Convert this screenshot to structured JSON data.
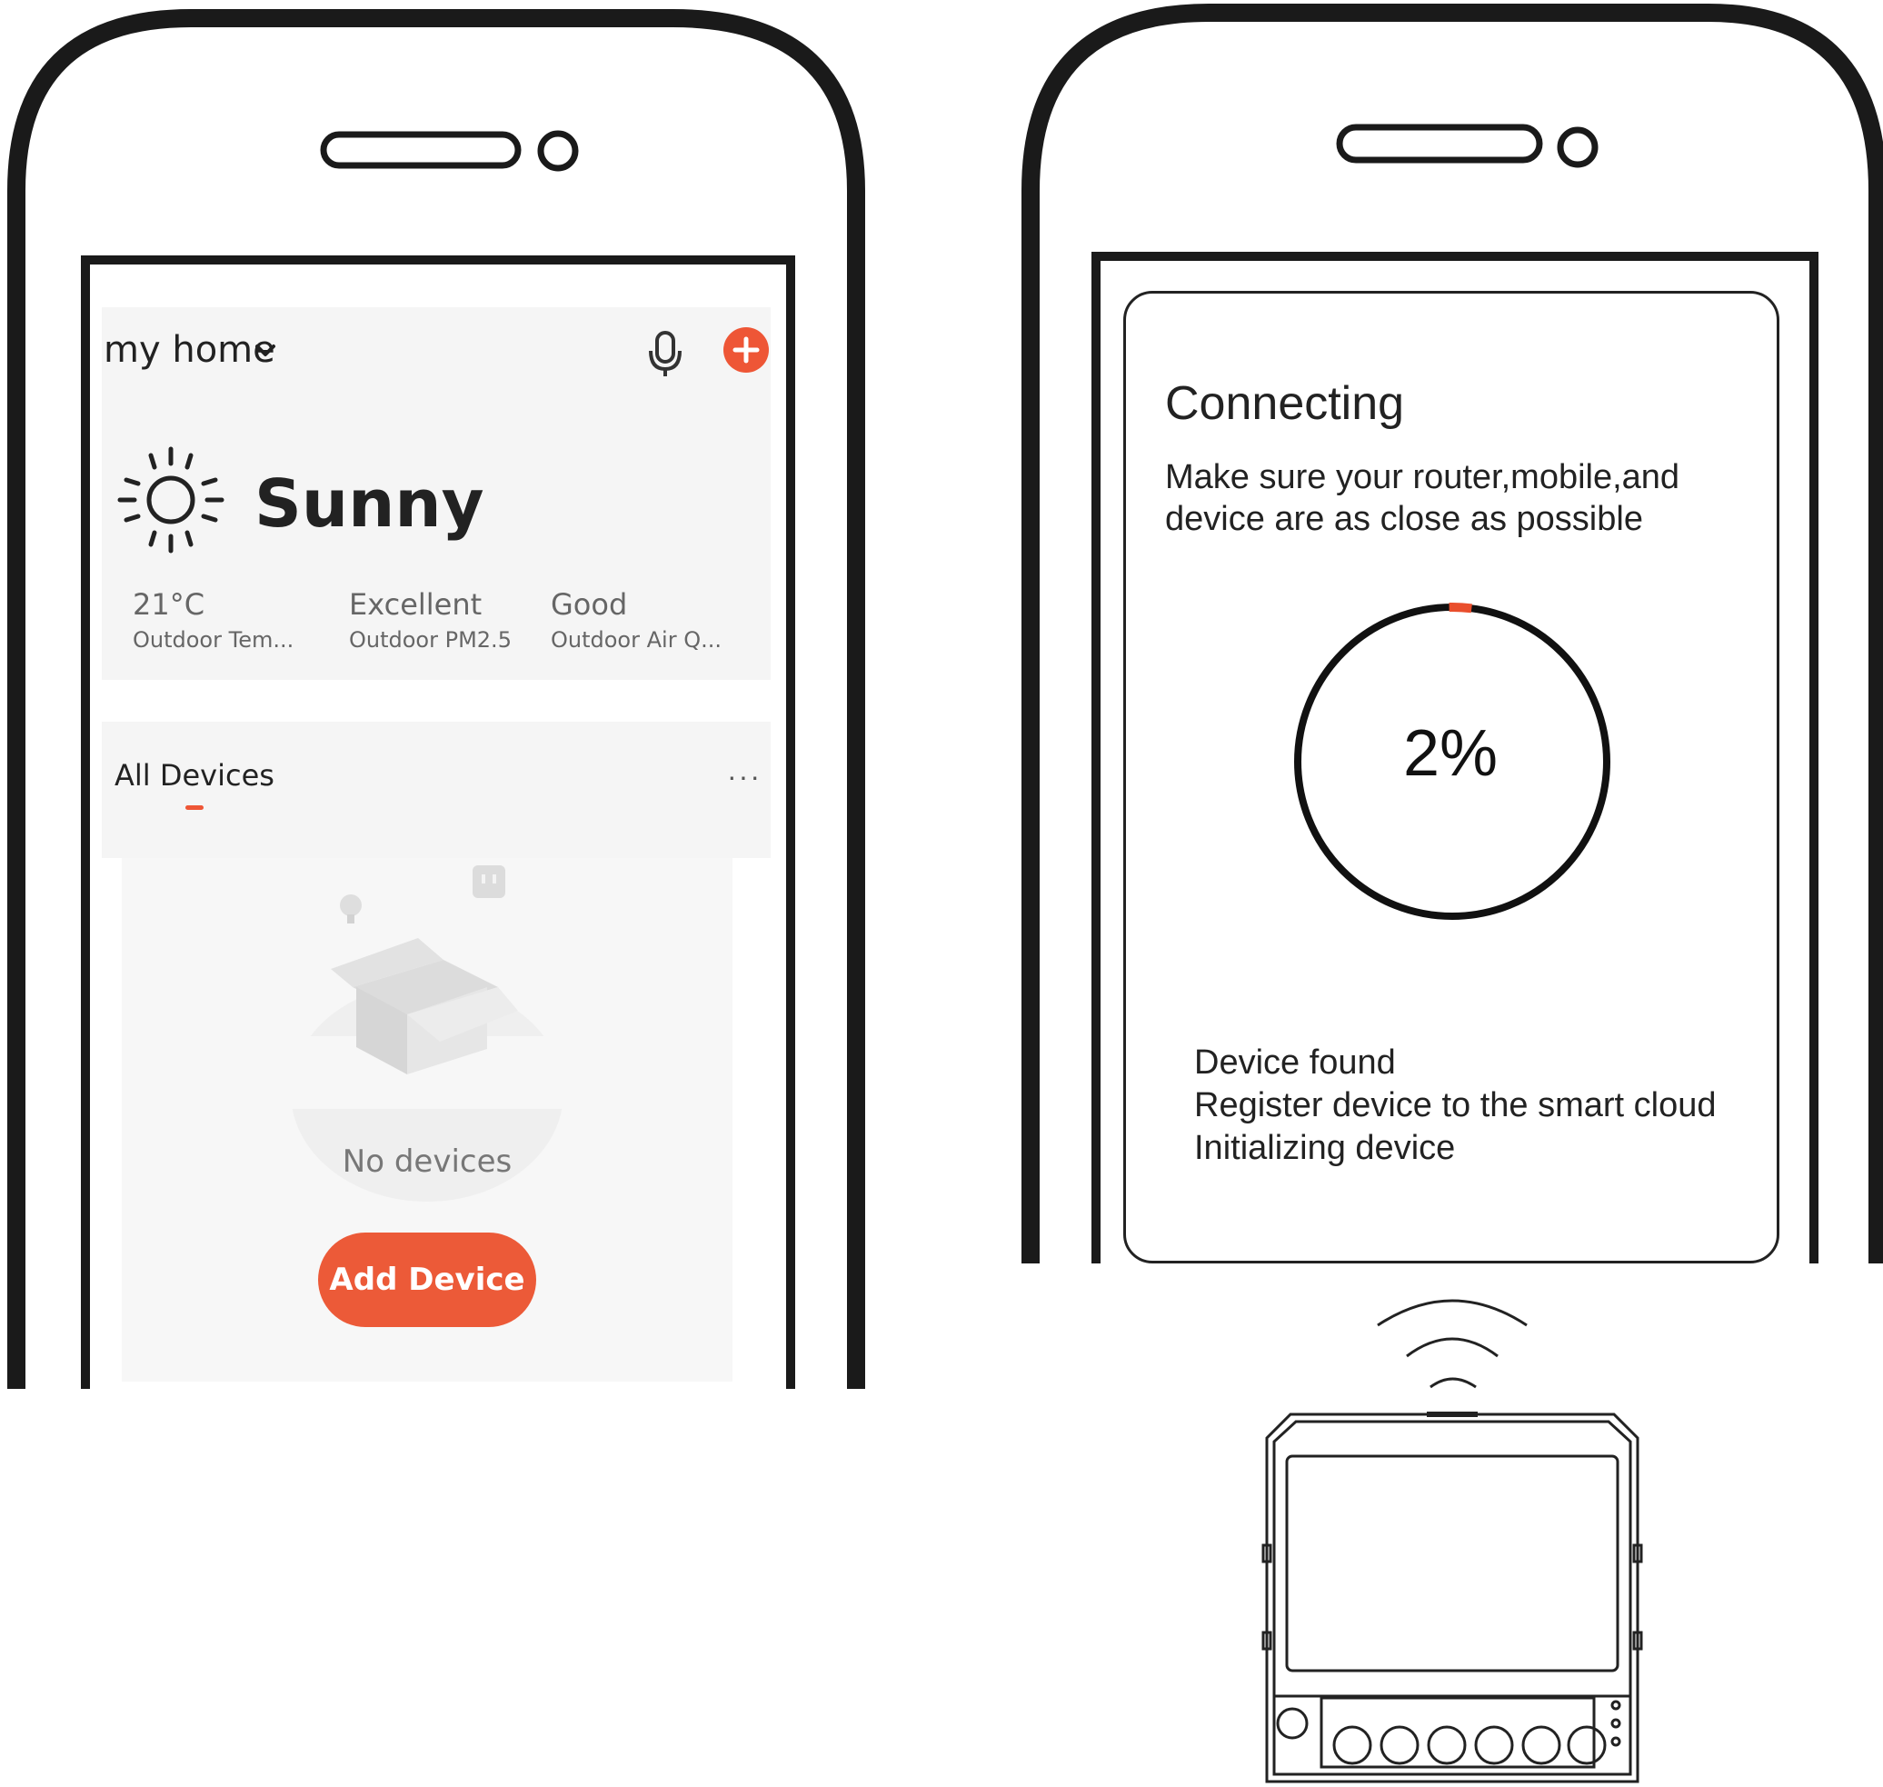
{
  "phone_left": {
    "header": {
      "home_label": "my home",
      "chevron_icon": "chevron-down-icon",
      "mic_icon": "microphone-icon",
      "add_icon": "plus-circle-icon",
      "accent_color": "#ee5636"
    },
    "weather": {
      "icon": "sun-icon",
      "condition": "Sunny",
      "stats": [
        {
          "value": "21°C",
          "label": "Outdoor Tem..."
        },
        {
          "value": "Excellent",
          "label": "Outdoor PM2.5"
        },
        {
          "value": "Good",
          "label": "Outdoor Air Q..."
        }
      ]
    },
    "tabs": {
      "active": "All Devices",
      "more_icon": "ellipsis-icon"
    },
    "empty_state": {
      "illustration": "empty-box-icon",
      "message": "No devices",
      "button_label": "Add Device"
    }
  },
  "phone_right": {
    "title": "Connecting",
    "description": "Make sure your router,mobile,and device are as close as possible",
    "progress": {
      "percent": 2,
      "label": "2%"
    },
    "steps": [
      "Device found",
      "Register device to the smart cloud",
      "Initializing device"
    ]
  },
  "device": {
    "icon": "smart-switch-device-icon",
    "signal_icon": "wifi-signal-icon"
  }
}
